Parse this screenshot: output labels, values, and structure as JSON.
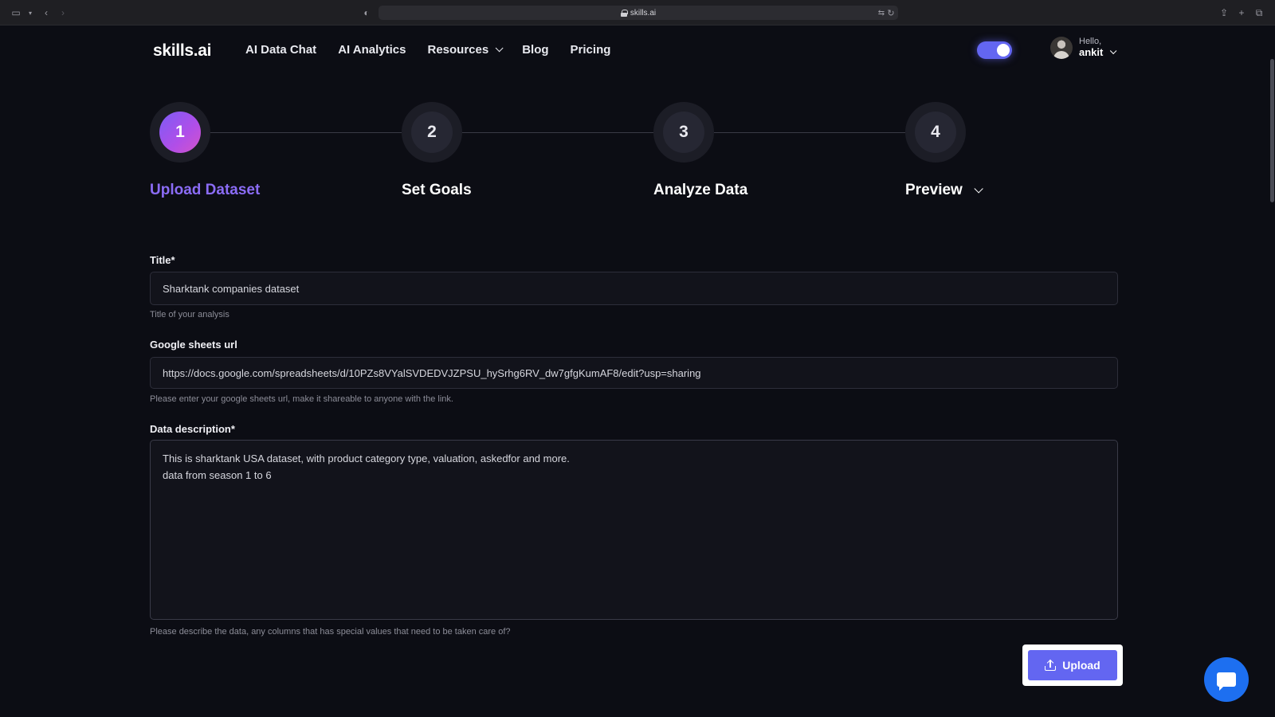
{
  "browser": {
    "url": "skills.ai"
  },
  "nav": {
    "logo": "skills.ai",
    "items": [
      {
        "label": "AI Data Chat"
      },
      {
        "label": "AI Analytics"
      },
      {
        "label": "Resources"
      },
      {
        "label": "Blog"
      },
      {
        "label": "Pricing"
      }
    ],
    "theme_toggle": {
      "on": true,
      "accent": "#6366f1"
    },
    "user": {
      "greeting": "Hello,",
      "name": "ankit"
    }
  },
  "stepper": {
    "steps": [
      {
        "number": "1",
        "label": "Upload Dataset",
        "active": true
      },
      {
        "number": "2",
        "label": "Set Goals",
        "active": false
      },
      {
        "number": "3",
        "label": "Analyze Data",
        "active": false
      },
      {
        "number": "4",
        "label": "Preview",
        "active": false
      }
    ]
  },
  "form": {
    "title": {
      "label": "Title*",
      "value": "Sharktank companies dataset",
      "help": "Title of your analysis"
    },
    "sheets_url": {
      "label": "Google sheets url",
      "value": "https://docs.google.com/spreadsheets/d/10PZs8VYalSVDEDVJZPSU_hySrhg6RV_dw7gfgKumAF8/edit?usp=sharing",
      "help": "Please enter your google sheets url, make it shareable to anyone with the link."
    },
    "description": {
      "label": "Data description*",
      "value": "This is sharktank USA dataset, with product category type, valuation, askedfor and more.\ndata from season 1 to 6",
      "help": "Please describe the data, any columns that has special values that need to be taken care of?"
    },
    "upload_label": "Upload"
  },
  "colors": {
    "accent": "#6366f1",
    "active_step": "#8b6cf6",
    "chat": "#1d6ff0",
    "background": "#0c0d14"
  }
}
